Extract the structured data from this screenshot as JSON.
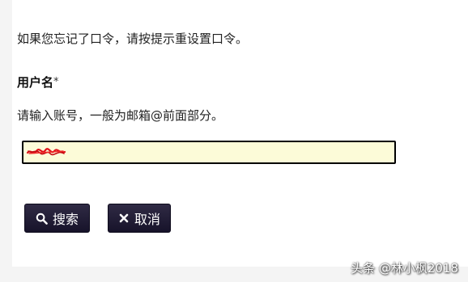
{
  "form": {
    "instructions": "如果您忘记了口令，请按提示重设置口令。",
    "username_label": "用户名",
    "required_mark": "*",
    "username_hint": "请输入账号，一般为邮箱@前面部分。",
    "username_value": "",
    "username_redacted": true
  },
  "buttons": {
    "search_label": "搜索",
    "search_icon": "search-icon",
    "cancel_label": "取消",
    "cancel_icon": "close-icon"
  },
  "watermark": {
    "text": "头条 @林小枫2018"
  },
  "colors": {
    "input_background": "#fcfbd8",
    "button_background": "#231e38",
    "redaction_mark": "#e0101a"
  }
}
